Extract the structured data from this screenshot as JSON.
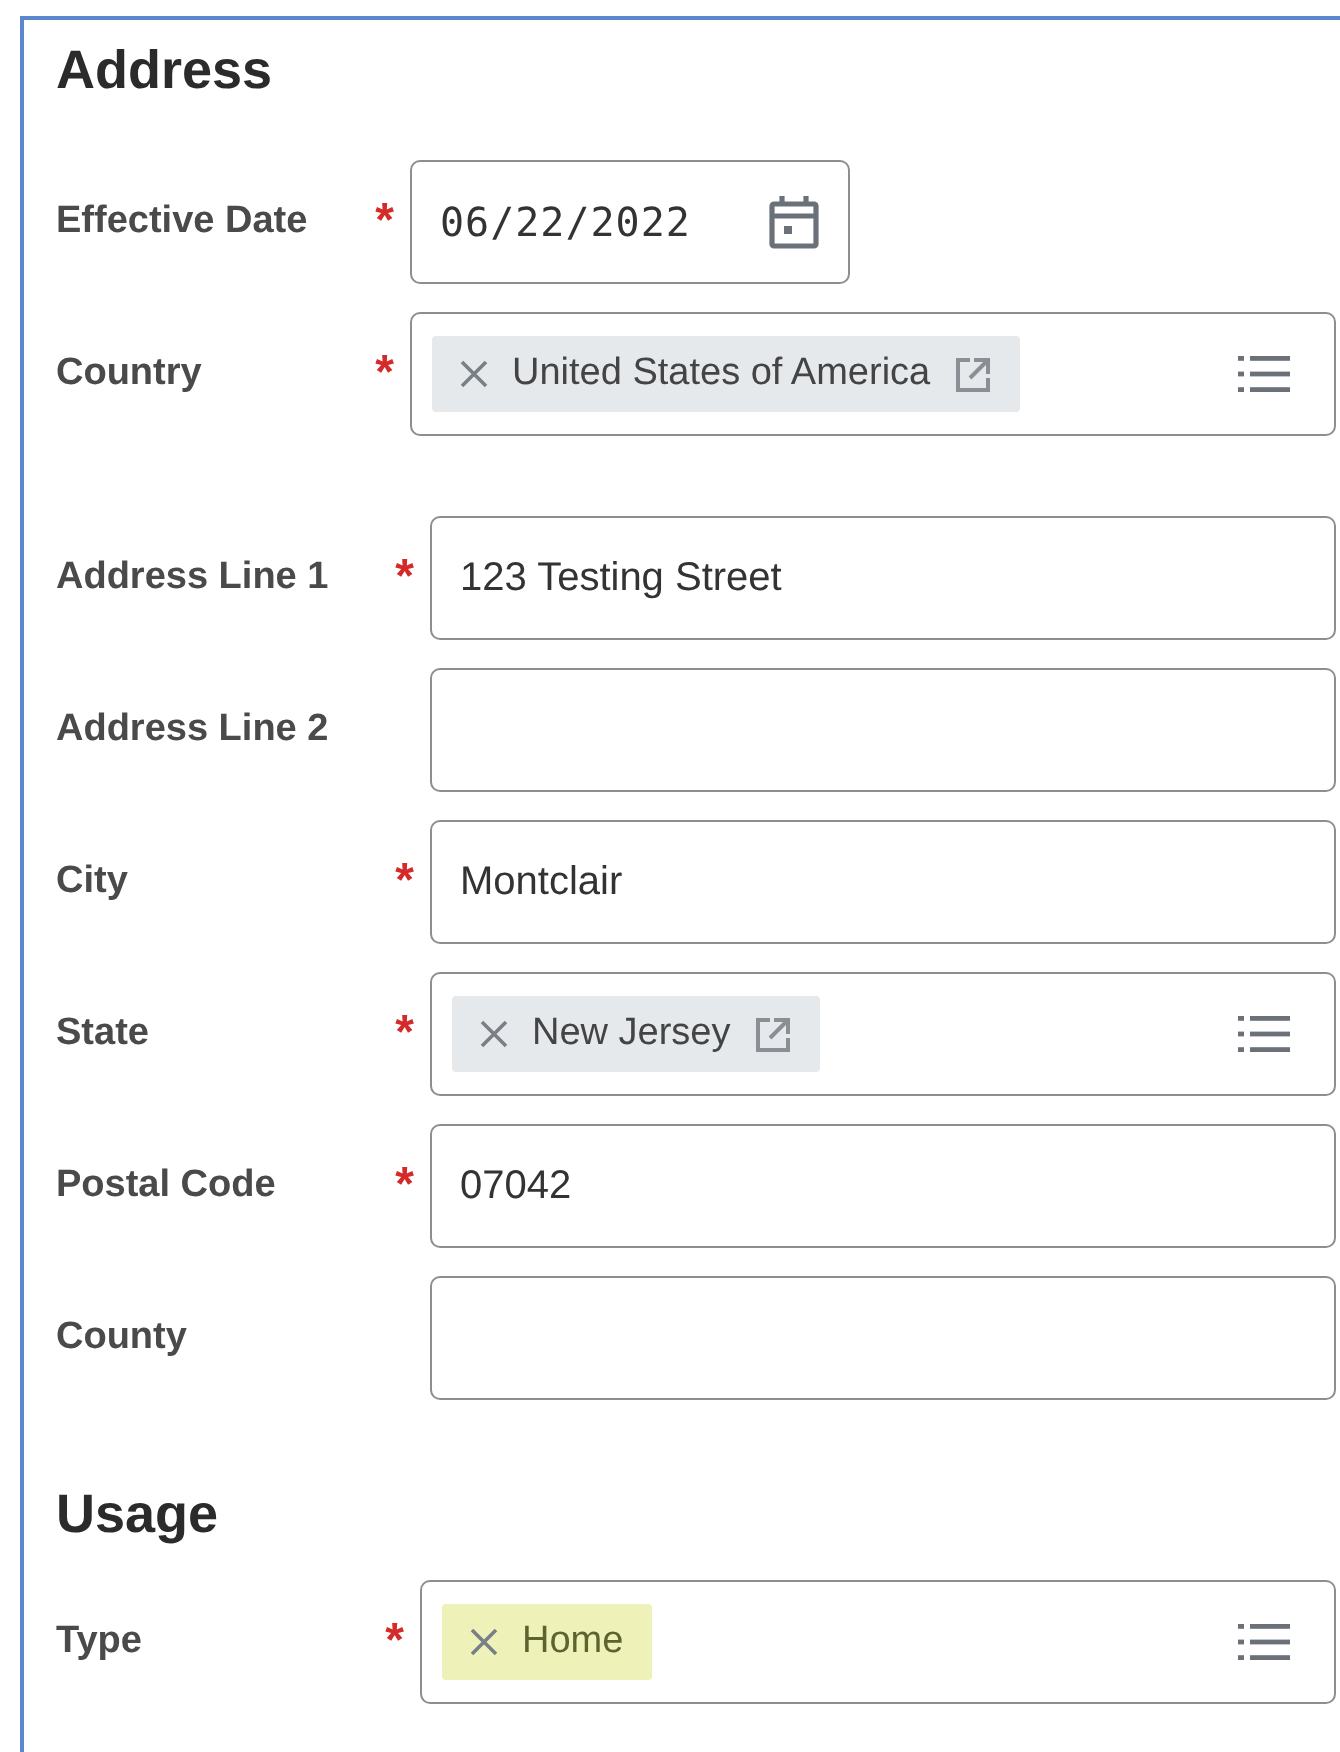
{
  "sections": [
    {
      "title": "Address",
      "groups": [
        {
          "fields": [
            {
              "label": "Effective Date",
              "required_mark": "*",
              "kind": "date",
              "value": "06/22/2022"
            },
            {
              "label": "Country",
              "required_mark": "*",
              "kind": "chips",
              "chips": [
                {
                  "text": "United States of America",
                  "link": true,
                  "highlighted": false
                }
              ]
            }
          ]
        },
        {
          "fields": [
            {
              "label": "Address Line 1",
              "required_mark": "*",
              "kind": "text",
              "value": "123 Testing Street"
            },
            {
              "label": "Address Line 2",
              "kind": "text"
            },
            {
              "label": "City",
              "required_mark": "*",
              "kind": "text",
              "value": "Montclair"
            },
            {
              "label": "State",
              "required_mark": "*",
              "kind": "chips",
              "chips": [
                {
                  "text": "New Jersey",
                  "link": true,
                  "highlighted": false
                }
              ]
            },
            {
              "label": "Postal Code",
              "required_mark": "*",
              "kind": "text",
              "value": "07042"
            },
            {
              "label": "County",
              "kind": "text"
            }
          ]
        }
      ]
    },
    {
      "title": "Usage",
      "groups": [
        {
          "fields": [
            {
              "label": "Type",
              "required_mark": "*",
              "kind": "chips",
              "chips": [
                {
                  "text": "Home",
                  "link": false,
                  "highlighted": true
                }
              ]
            }
          ]
        }
      ]
    }
  ]
}
